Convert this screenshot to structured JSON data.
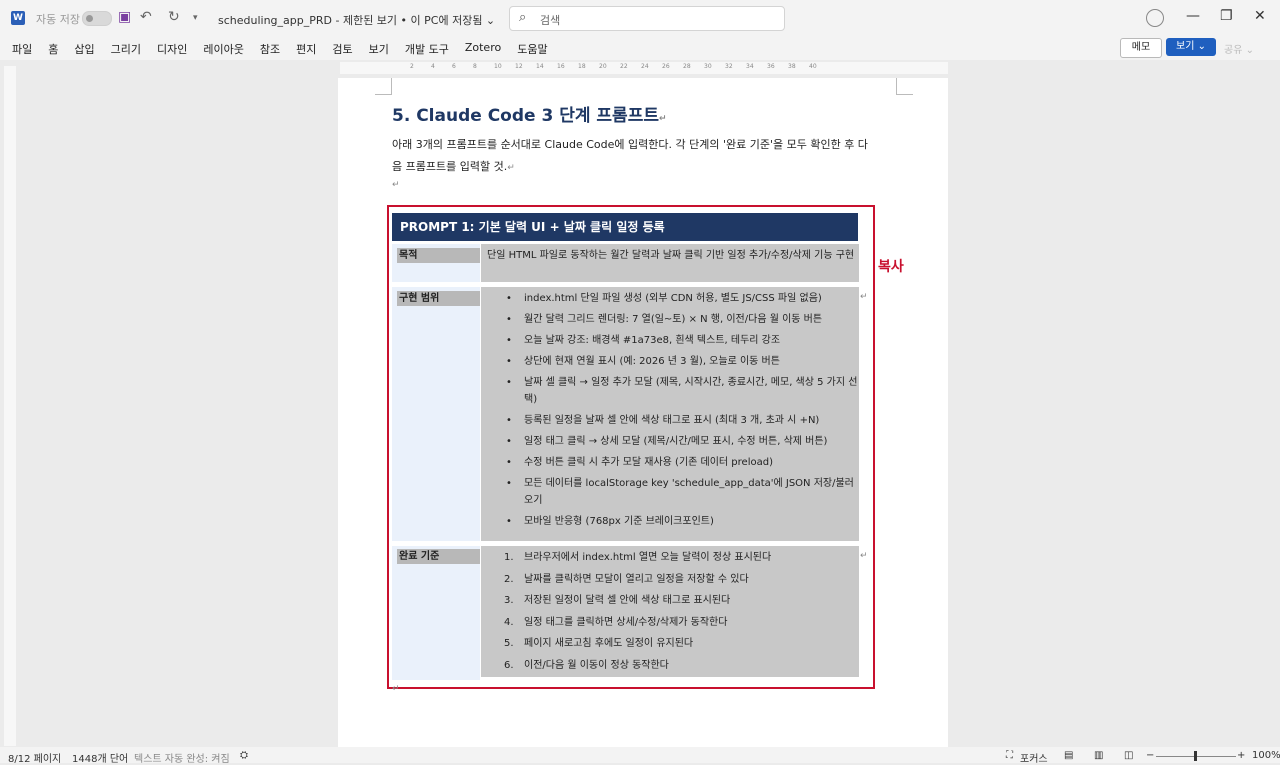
{
  "titlebar": {
    "autosave_label": "자동 저장",
    "document_title": "scheduling_app_PRD  -  제한된 보기 • 이 PC에 저장됨 ⌄",
    "search_placeholder": "검색"
  },
  "menu": [
    "파일",
    "홈",
    "삽입",
    "그리기",
    "디자인",
    "레이아웃",
    "참조",
    "편지",
    "검토",
    "보기",
    "개발 도구",
    "Zotero",
    "도움말"
  ],
  "ribbon_buttons": {
    "memo": "메모",
    "view": "보기 ⌄",
    "share": "공유 ⌄"
  },
  "ruler_marks": [
    "2",
    "4",
    "6",
    "8",
    "10",
    "12",
    "14",
    "16",
    "18",
    "20",
    "22",
    "24",
    "26",
    "28",
    "30",
    "32",
    "34",
    "36",
    "38",
    "40"
  ],
  "document": {
    "heading": "5. Claude Code 3 단계 프롬프트",
    "para_line1": "아래 3개의 프롬프트를 순서대로 Claude Code에 입력한다. 각 단계의 '완료 기준'을 모두 확인한 후 다",
    "para_line2": "음 프롬프트를 입력할 것.",
    "para_mark": "↵",
    "prompt_title": "PROMPT 1: 기본 달력 UI + 날짜 클릭 일정 등록",
    "copy_label": "복사",
    "purpose_label": "목적",
    "purpose_text": "단일 HTML 파일로 동작하는 월간 달력과 날짜 클릭 기반 일정 추가/수정/삭제 기능 구현",
    "scope_label": "구현 범위",
    "scope_items": [
      "index.html 단일 파일 생성 (외부 CDN 허용, 별도 JS/CSS 파일 없음)",
      "월간 달력 그리드 렌더링: 7 열(일~토) × N 행, 이전/다음 월 이동 버튼",
      "오늘 날짜 강조: 배경색 #1a73e8, 흰색 텍스트, 테두리 강조",
      "상단에 현재 연월 표시 (예: 2026 년 3 월), 오늘로 이동 버튼",
      "날짜 셀 클릭 → 일정 추가 모달 (제목, 시작시간, 종료시간, 메모, 색상 5 가지 선택)",
      "등록된 일정을 날짜 셀 안에 색상 태그로 표시 (최대 3 개, 초과 시 +N)",
      "일정 태그 클릭 → 상세 모달 (제목/시간/메모 표시, 수정 버튼, 삭제 버튼)",
      "수정 버튼 클릭 시 추가 모달 재사용 (기존 데이터 preload)",
      "모든 데이터를 localStorage key 'schedule_app_data'에 JSON 저장/불러오기",
      "모바일 반응형 (768px 기준 브레이크포인트)"
    ],
    "criteria_label": "완료 기준",
    "criteria_items": [
      "브라우저에서 index.html 열면 오늘 달력이 정상 표시된다",
      "날짜를 클릭하면 모달이 열리고 일정을 저장할 수 있다",
      "저장된 일정이 달력 셀 안에 색상 태그로 표시된다",
      "일정 태그를 클릭하면 상세/수정/삭제가 동작한다",
      "페이지 새로고침 후에도 일정이 유지된다",
      "이전/다음 월 이동이 정상 동작한다"
    ]
  },
  "statusbar": {
    "page": "8/12 페이지",
    "words": "1448개 단어",
    "autocomplete": "텍스트 자동 완성: 켜짐",
    "focus": "포커스",
    "zoom": "100%"
  },
  "colors": {
    "accent": "#1f3864",
    "highlight_red": "#c8102e",
    "button_blue": "#1f5fbf"
  }
}
